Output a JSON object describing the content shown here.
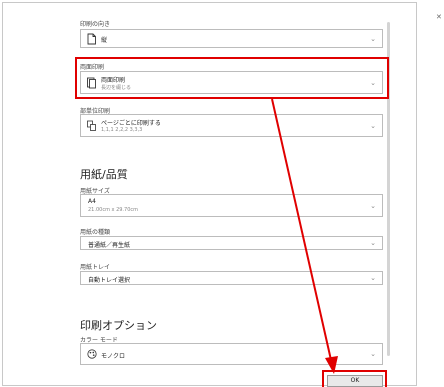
{
  "close_label": "✕",
  "orientation": {
    "label": "印刷の向き",
    "value": "縦"
  },
  "duplex": {
    "label": "両面印刷",
    "value": "両面印刷",
    "sub": "長辺を綴じる"
  },
  "collate": {
    "label": "部単位印刷",
    "value": "ページごとに印刷する",
    "sub": "1,1,1 2,2,2 3,3,3"
  },
  "paper_quality": {
    "title": "用紙/品質",
    "size": {
      "label": "用紙サイズ",
      "value": "A4",
      "sub": "21.00cm x 29.70cm"
    },
    "type": {
      "label": "用紙の種類",
      "value": "普通紙／再生紙"
    },
    "tray": {
      "label": "用紙トレイ",
      "value": "自動トレイ選択"
    }
  },
  "print_options": {
    "title": "印刷オプション",
    "color_mode": {
      "label": "カラー モード",
      "value": "モノクロ"
    }
  },
  "ok_button": "OK",
  "colors": {
    "highlight": "#e00000",
    "border": "#bcbcbc"
  },
  "icons": {
    "close": "close-icon",
    "portrait": "portrait-page-icon",
    "duplex": "duplex-icon",
    "collate": "collate-icon",
    "color_mode": "color-mode-icon",
    "chevron": "chevron-down-icon"
  }
}
